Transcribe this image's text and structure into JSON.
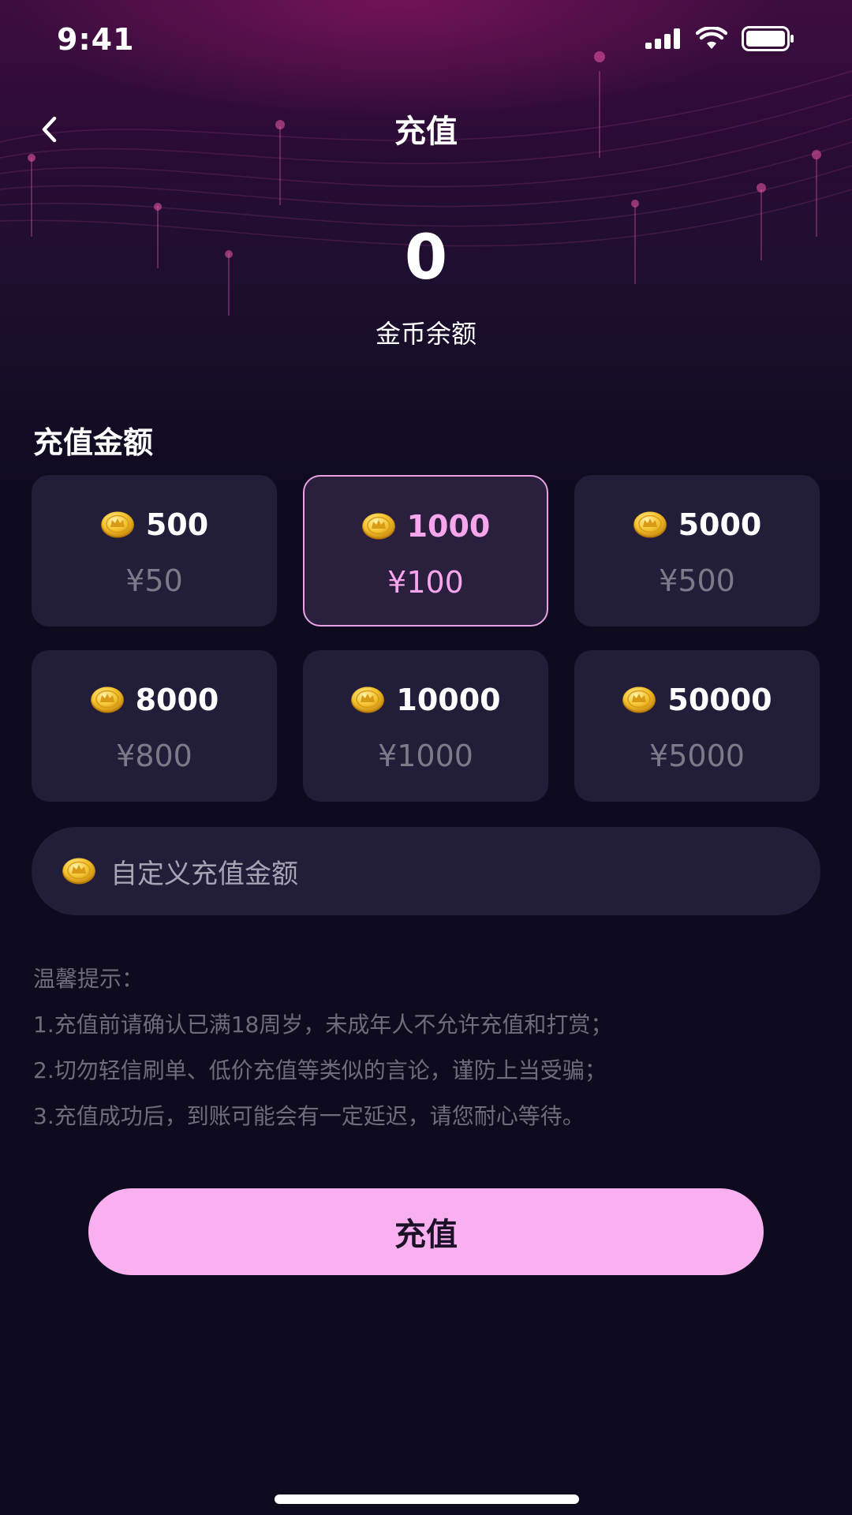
{
  "status_bar": {
    "time": "9:41",
    "icons": [
      "signal-icon",
      "wifi-icon",
      "battery-icon"
    ]
  },
  "header": {
    "title": "充值",
    "back_icon": "chevron-left-icon"
  },
  "balance": {
    "value": "0",
    "label": "金币余额"
  },
  "packages": {
    "title": "充值金额",
    "items": [
      {
        "coins": "500",
        "price": "¥50",
        "selected": false
      },
      {
        "coins": "1000",
        "price": "¥100",
        "selected": true
      },
      {
        "coins": "5000",
        "price": "¥500",
        "selected": false
      },
      {
        "coins": "8000",
        "price": "¥800",
        "selected": false
      },
      {
        "coins": "10000",
        "price": "¥1000",
        "selected": false
      },
      {
        "coins": "50000",
        "price": "¥5000",
        "selected": false
      }
    ]
  },
  "custom": {
    "placeholder": "自定义充值金额",
    "icon": "coin-icon"
  },
  "tips": {
    "title": "温馨提示：",
    "lines": [
      "1.充值前请确认已满18周岁，未成年人不允许充值和打赏；",
      "2.切勿轻信刷单、低价充值等类似的言论，谨防上当受骗；",
      "3.充值成功后，到账可能会有一定延迟，请您耐心等待。"
    ]
  },
  "action": {
    "recharge_label": "充值"
  },
  "colors": {
    "accent": "#f9b0f1",
    "selected_text": "#f7a6ee",
    "card_bg": "#221d39",
    "page_bg": "#0f0b1f"
  }
}
